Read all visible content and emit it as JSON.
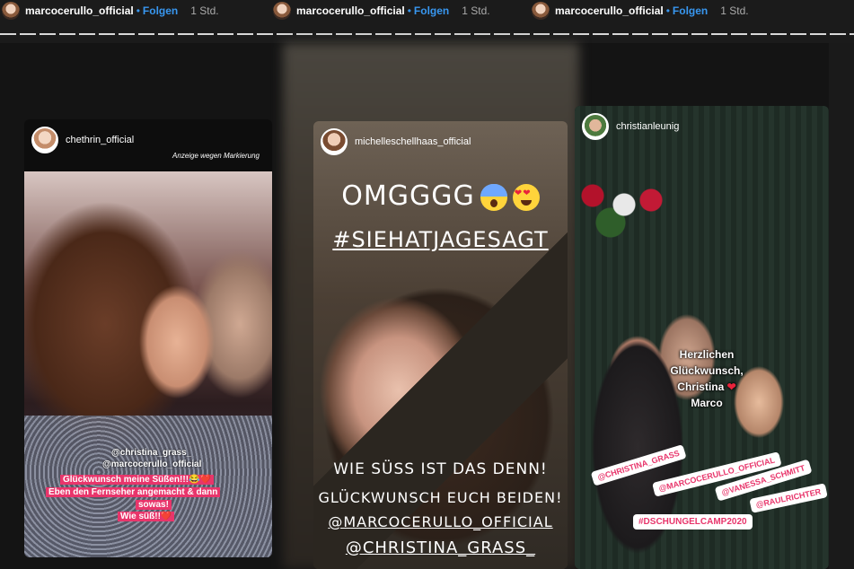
{
  "topbar": {
    "segments": [
      {
        "username": "marcocerullo_official",
        "separator": "•",
        "follow": "Folgen",
        "time": "1 Std."
      },
      {
        "username": "marcocerullo_official",
        "separator": "•",
        "follow": "Folgen",
        "time": "1 Std."
      },
      {
        "username": "marcocerullo_official",
        "separator": "•",
        "follow": "Folgen",
        "time": "1 Std."
      }
    ]
  },
  "stories": {
    "left": {
      "username": "chethrin_official",
      "ad_label": "Anzeige wegen Markierung",
      "caption": {
        "line1": "@christina_grass_",
        "line2": "@marcocerullo_official",
        "line3": "Glückwunsch meine Süßen!!!😂❤️",
        "line4": "Eben den Fernseher angemacht & dann",
        "line5": "sowas!",
        "line6": "Wie süß!!❤️"
      }
    },
    "middle": {
      "username": "michelleschellhaas_official",
      "headline": "OMGGGG",
      "hashtag": "#SIEHATJAGESAGT",
      "text1": "WIE SÜSS IST DAS DENN!",
      "text2": "GLÜCKWUNSCH EUCH BEIDEN!",
      "mention1": "@MARCOCERULLO_OFFICIAL",
      "mention2": "@CHRISTINA_GRASS_"
    },
    "right": {
      "username": "christianleunig",
      "congrats": {
        "line1": "Herzlichen",
        "line2": "Glückwunsch,",
        "line3": "Christina",
        "line4": "Marco"
      },
      "tags": [
        "@CHRISTINA_GRASS",
        "@MARCOCERULLO_OFFICIAL",
        "@VANESSA_SCHMITT",
        "@RAULRICHTER"
      ],
      "hashtag": "#DSCHUNGELCAMP2020"
    }
  },
  "colors": {
    "accent": "#3897f0",
    "caption_bg": "#e8356b",
    "heart": "#e8233b"
  }
}
